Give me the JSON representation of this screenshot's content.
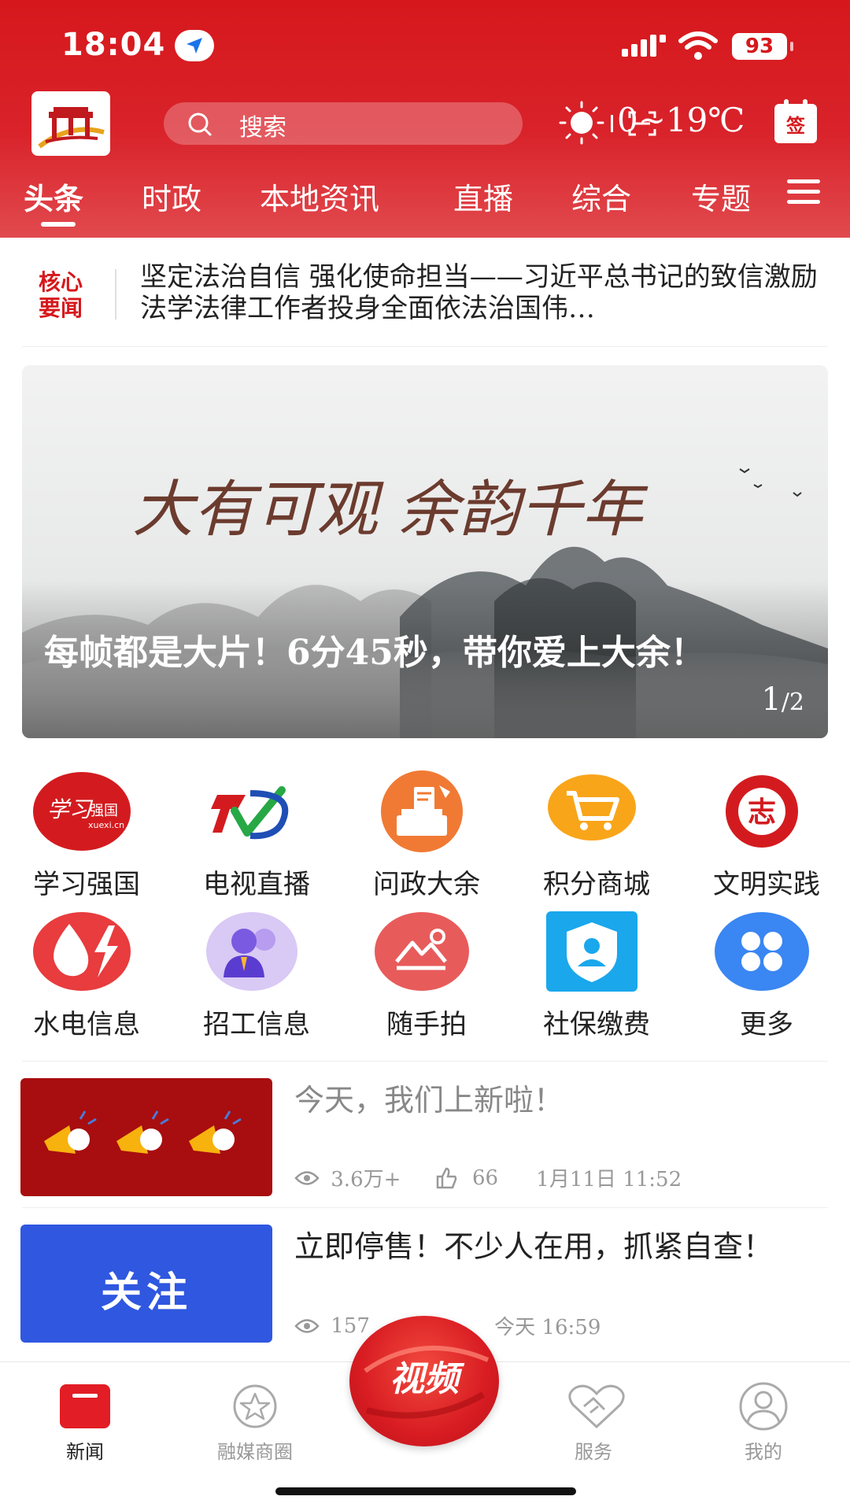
{
  "status_bar": {
    "time": "18:04",
    "battery": "93"
  },
  "header": {
    "search_placeholder": "搜索",
    "weather": "0~19℃",
    "signin_label": "签",
    "tabs": [
      "头条",
      "时政",
      "本地资讯",
      "直播",
      "综合",
      "专题"
    ],
    "active_tab": "头条"
  },
  "core_news": {
    "badge_line1": "核心",
    "badge_line2": "要闻",
    "headline": "坚定法治自信  强化使命担当——习近平总书记的致信激励法学法律工作者投身全面依法治国伟…"
  },
  "banner": {
    "calligraphy": "大有可观  余韵千年",
    "title": "每帧都是大片！6分45秒，带你爱上大余！",
    "page_current": "1",
    "page_total": "/2"
  },
  "shortcuts": [
    {
      "label": "学习强国",
      "icon": "xuexi-qiangguo-icon"
    },
    {
      "label": "电视直播",
      "icon": "tv-live-icon"
    },
    {
      "label": "问政大余",
      "icon": "ballot-box-icon"
    },
    {
      "label": "积分商城",
      "icon": "shopping-cart-icon"
    },
    {
      "label": "文明实践",
      "icon": "volunteer-seal-icon"
    },
    {
      "label": "水电信息",
      "icon": "water-electric-icon"
    },
    {
      "label": "招工信息",
      "icon": "recruitment-icon"
    },
    {
      "label": "随手拍",
      "icon": "photo-icon"
    },
    {
      "label": "社保缴费",
      "icon": "social-security-icon"
    },
    {
      "label": "更多",
      "icon": "more-grid-icon"
    }
  ],
  "feed": [
    {
      "title": "今天，我们上新啦！",
      "views": "3.6万+",
      "likes": "66",
      "time": "1月11日  11:52",
      "thumb": "megaphones-icon"
    },
    {
      "title": "立即停售！不少人在用，抓紧自查！",
      "views": "157",
      "time": "今天  16:59",
      "thumb_text": "关注"
    }
  ],
  "bottom_nav": {
    "items": [
      "新闻",
      "融媒商圈",
      "服务",
      "我的"
    ],
    "center": "视频",
    "active": "新闻"
  },
  "colors": {
    "brand_red": "#d6181c",
    "follow_blue": "#2f57e0"
  }
}
